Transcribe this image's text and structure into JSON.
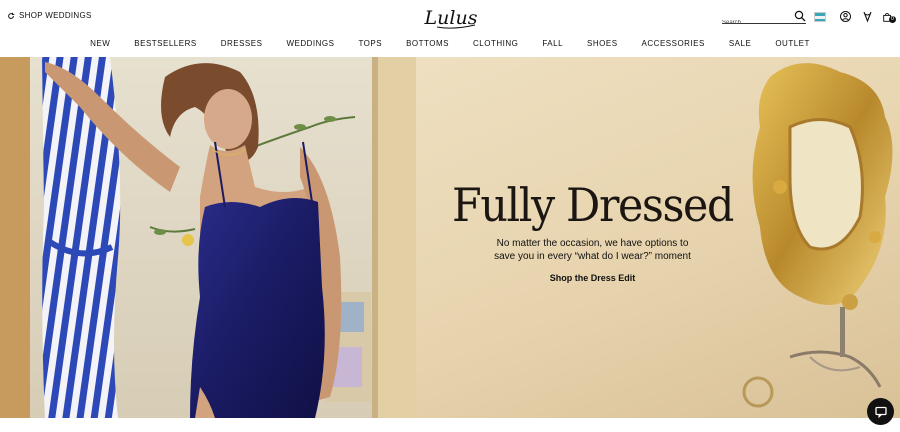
{
  "topbar": {
    "shop_weddings": "SHOP WEDDINGS",
    "logo_text": "Lulus",
    "search_placeholder": "Search",
    "cart_count": "0"
  },
  "nav": {
    "items": [
      "NEW",
      "BESTSELLERS",
      "DRESSES",
      "WEDDINGS",
      "TOPS",
      "BOTTOMS",
      "CLOTHING",
      "FALL",
      "SHOES",
      "ACCESSORIES",
      "SALE",
      "OUTLET"
    ]
  },
  "hero": {
    "title": "Fully Dressed",
    "subtitle_line1": "No matter the occasion, we have options to",
    "subtitle_line2": "save you in every “what do I wear?” moment",
    "cta": "Shop the Dress Edit"
  },
  "icons": {
    "shop_weddings": "refresh-icon",
    "search": "search-icon",
    "flag": "flag-icon",
    "account": "account-icon",
    "wishlist": "wishlist-icon",
    "cart": "shopping-bag-icon",
    "chat": "chat-icon"
  },
  "colors": {
    "accent_text": "#111111",
    "hero_bg": "#eadbbd",
    "dress": "#1f1f6e"
  }
}
